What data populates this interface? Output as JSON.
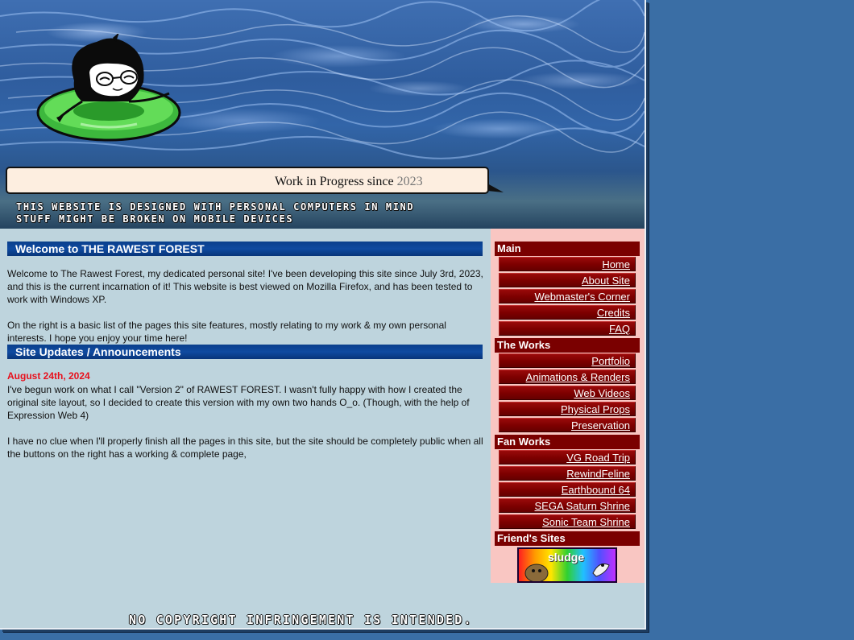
{
  "header": {
    "wip_text": "Work in Progress since",
    "wip_year": "2023",
    "notice_line1": "THIS WEBSITE IS DESIGNED WITH PERSONAL COMPUTERS IN MIND",
    "notice_line2": "STUFF MIGHT BE BROKEN ON MOBILE DEVICES"
  },
  "main": {
    "welcome_heading": "Welcome to THE RAWEST FOREST",
    "welcome_para1": "Welcome to The Rawest Forest, my dedicated personal site! I've been developing this site since July 3rd, 2023, and this is the current incarnation of it! This website is best viewed on Mozilla Firefox, and has been tested to work with Windows XP.",
    "welcome_para2": "On the right is a basic list of the pages this site features, mostly relating to my work & my own personal interests. I hope you enjoy your time here!",
    "updates_heading": "Site Updates / Announcements",
    "update_date": "August 24th, 2024",
    "update_para1": "I've begun work on what I call \"Version 2\" of RAWEST FOREST. I wasn't fully happy with how I created the original site layout, so I decided to create this version with my own two hands O_o. (Though, with the help of Expression Web 4)",
    "update_para2": "I have no clue when I'll properly finish all the pages in this site, but the site should be completely public when all the buttons on the right has a working & complete page,"
  },
  "sidebar": {
    "sections": [
      {
        "title": "Main",
        "links": [
          "Home",
          "About Site",
          "Webmaster's Corner",
          "Credits",
          "FAQ"
        ]
      },
      {
        "title": "The Works",
        "links": [
          "Portfolio",
          "Animations & Renders",
          "Web Videos",
          "Physical Props",
          "Preservation"
        ]
      },
      {
        "title": "Fan Works",
        "links": [
          "VG Road Trip",
          "RewindFeline",
          "Earthbound 64",
          "SEGA Saturn Shrine",
          "Sonic Team Shrine"
        ]
      },
      {
        "title": "Friend's Sites",
        "links": []
      }
    ],
    "friend_button_label": "sludge"
  },
  "footer": {
    "text": "NO COPYRIGHT INFRINGEMENT IS INTENDED."
  },
  "colors": {
    "desktop_bg": "#3a6ea5",
    "content_bg": "#bed4dd",
    "sidebar_bg": "#f9c6c2",
    "nav_red": "#7a0000",
    "heading_blue": "#0a3f8c",
    "date_red": "#e8101c"
  }
}
